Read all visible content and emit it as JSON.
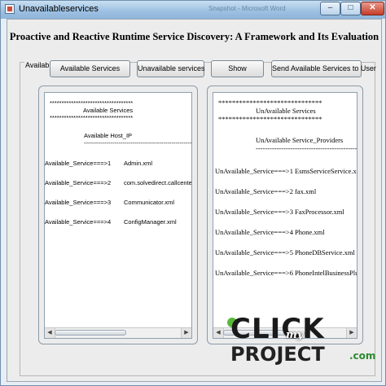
{
  "window": {
    "title": "Unavailableservices",
    "faded_title": "Snapshot - Microsoft Word",
    "controls": {
      "minimize": "–",
      "maximize": "□",
      "close": "✕"
    }
  },
  "heading": "Proactive and Reactive Runtime Service Discovery: A Framework and Its Evaluation",
  "group_label": "Available_services",
  "buttons": {
    "available": "Available Services",
    "unavailable": "Unavailable services",
    "show": "Show",
    "send": "Send Available Services to User"
  },
  "left_panel": {
    "stars": "***********************************",
    "title": "Available Services",
    "host_label": "Available Host_IP",
    "rule": "-------------------------------------------------------",
    "rows": [
      {
        "key": "Available_Service===>1",
        "value": "Admin.xml"
      },
      {
        "key": "Available_Service===>2",
        "value": "com.solvedirect.callcenter.c"
      },
      {
        "key": "Available_Service===>3",
        "value": "Communicator.xml"
      },
      {
        "key": "Available_Service===>4",
        "value": "ConfigManager.xml"
      }
    ],
    "scroll_left": "◀",
    "scroll_right": "▶",
    "scroll_position": 0.0
  },
  "right_panel": {
    "stars": "******************************",
    "title": "UnAvailable Services",
    "providers_label": "UnAvailable Service_Providers",
    "rule": "----------------------------------------------",
    "rows": [
      {
        "key": "UnAvailable_Service===>1",
        "value": "EsmsServiceService.xml"
      },
      {
        "key": "UnAvailable_Service===>2",
        "value": "fax.xml"
      },
      {
        "key": "UnAvailable_Service===>3",
        "value": "FaxProcessor.xml"
      },
      {
        "key": "UnAvailable_Service===>4",
        "value": "Phone.xml"
      },
      {
        "key": "UnAvailable_Service===>5",
        "value": "PhoneDBService.xml"
      },
      {
        "key": "UnAvailable_Service===>6",
        "value": "PhoneIntelBusinessPlus.xr"
      }
    ],
    "scroll_left": "◀",
    "scroll_right": "▶",
    "scroll_position": 0.0
  },
  "watermark": {
    "click": "CLICK",
    "my": "my",
    "project": "PROJECT",
    "com": ".com"
  }
}
